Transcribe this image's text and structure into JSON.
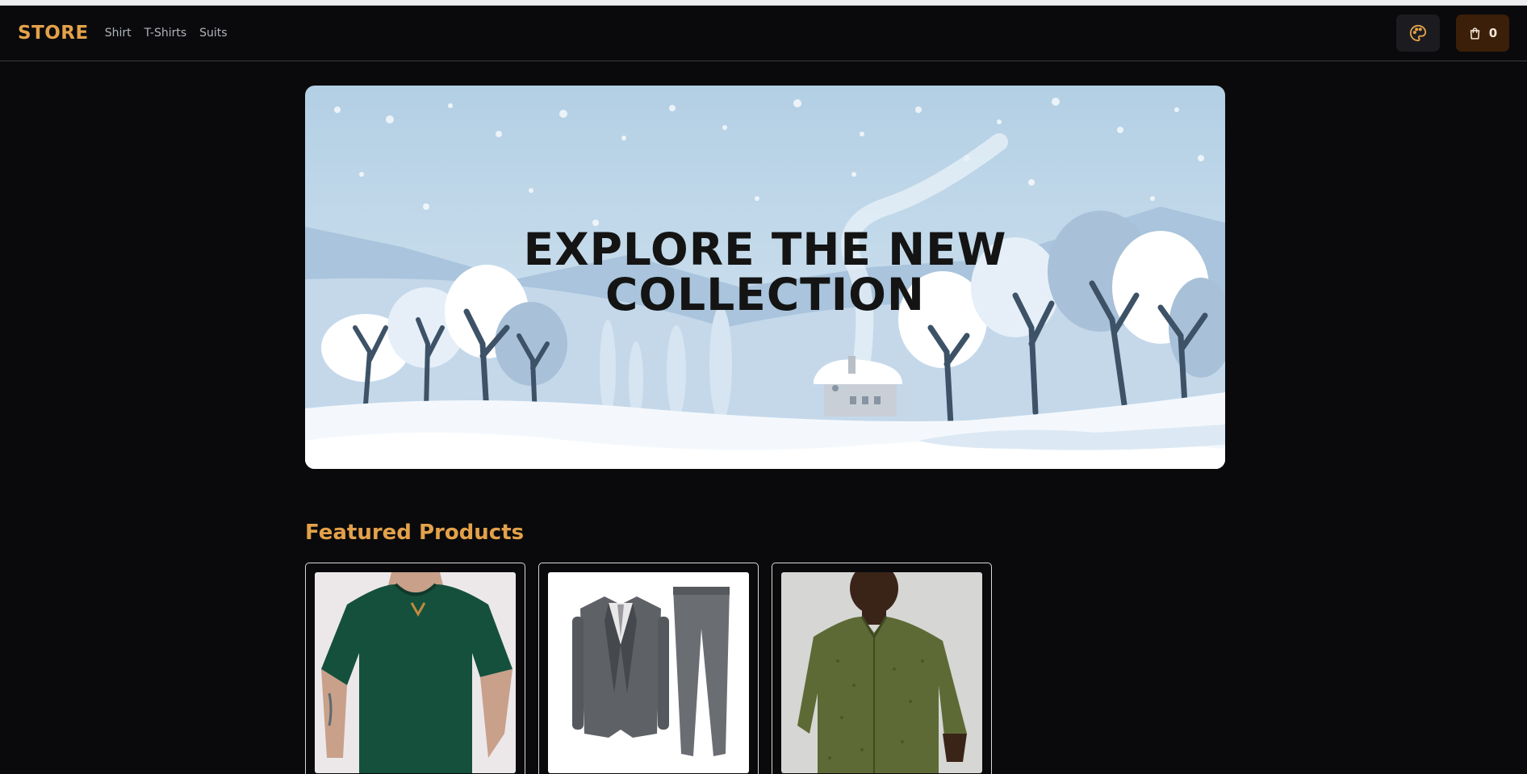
{
  "header": {
    "logo": "STORE",
    "nav": [
      {
        "label": "Shirt"
      },
      {
        "label": "T-Shirts"
      },
      {
        "label": "Suits"
      }
    ],
    "theme_icon": "palette-icon",
    "cart_icon": "shopping-bag-icon",
    "cart_count": "0"
  },
  "hero": {
    "title_line1": "EXPLORE THE NEW",
    "title_line2": "COLLECTION"
  },
  "featured": {
    "title": "Featured Products",
    "products": [
      {
        "image": "green-tshirt-model"
      },
      {
        "image": "grey-three-piece-suit"
      },
      {
        "image": "olive-printed-shirt-model"
      }
    ]
  },
  "colors": {
    "accent": "#e3a14a",
    "background": "#0a0a0c",
    "cart_bg": "#3b1f08"
  }
}
